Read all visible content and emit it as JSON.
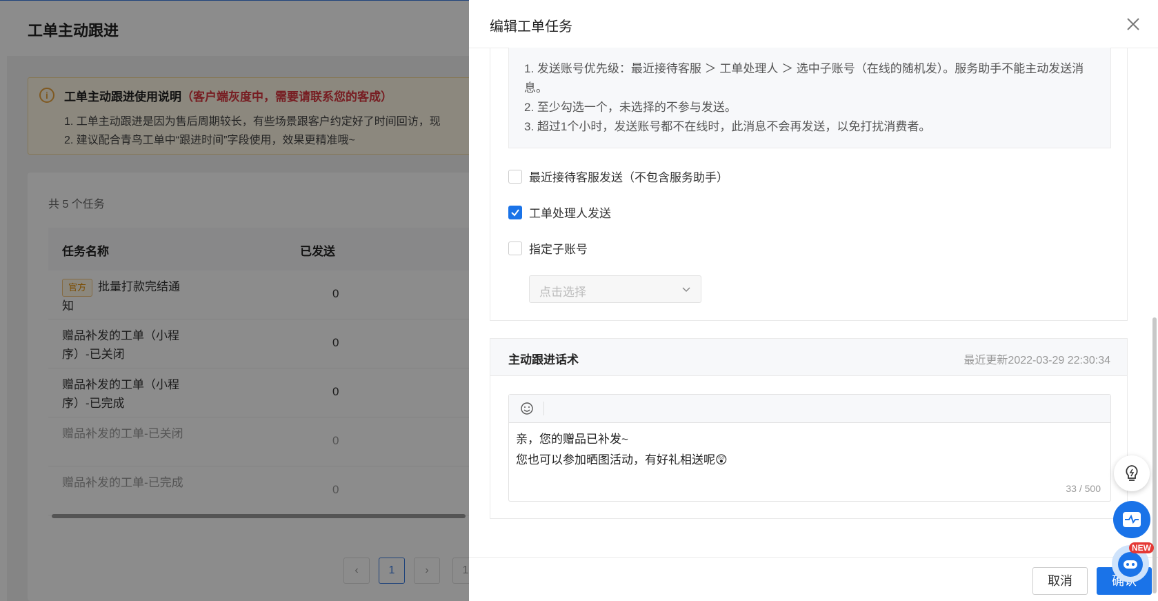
{
  "background": {
    "page_title": "工单主动跟进",
    "notice": {
      "title": "工单主动跟进使用说明",
      "title_note": "（客户端灰度中，需要请联系您的客成）",
      "line1": "1. 工单主动跟进是因为售后周期较长，有些场景跟客户约定好了时间回访，现",
      "line2": "2. 建议配合青鸟工单中“跟进时间”字段使用，效果更精准哦~"
    },
    "total": "共 5 个任务",
    "table": {
      "headers": [
        "任务名称",
        "已发送"
      ],
      "rows": [
        {
          "tag": "官方",
          "name": "批量打款完结通知",
          "sent": "0"
        },
        {
          "tag": "",
          "name": "赠品补发的工单（小程序）-已关闭",
          "sent": "0"
        },
        {
          "tag": "",
          "name": "赠品补发的工单（小程序）-已完成",
          "sent": "0"
        },
        {
          "tag": "",
          "name": "赠品补发的工单-已关闭",
          "sent": "0"
        },
        {
          "tag": "",
          "name": "赠品补发的工单-已完成",
          "sent": "0"
        }
      ]
    },
    "pager": {
      "prev": "‹",
      "current": "1",
      "next": "›",
      "goto": "1"
    }
  },
  "drawer": {
    "title": "编辑工单任务",
    "tips": [
      "1. 发送账号优先级：最近接待客服 ＞ 工单处理人 ＞ 选中子账号（在线的随机发）。服务助手不能主动发送消息。",
      "2. 至少勾选一个，未选择的不参与发送。",
      "3. 超过1个小时，发送账号都不在线时，此消息不会再发送，以免打扰消费者。"
    ],
    "options": [
      {
        "label": "最近接待客服发送（不包含服务助手）",
        "checked": false
      },
      {
        "label": "工单处理人发送",
        "checked": true
      },
      {
        "label": "指定子账号",
        "checked": false
      }
    ],
    "select_placeholder": "点击选择",
    "script_section": {
      "title": "主动跟进话术",
      "updated": "最近更新2022-03-29 22:30:34",
      "line1": "亲，您的赠品已补发~",
      "line2": "您也可以参加晒图活动，有好礼相送呢😲",
      "counter": "33 / 500"
    },
    "cancel_label": "取消",
    "ok_label": "确认"
  },
  "widgets": {
    "new_badge": "NEW"
  },
  "colors": {
    "primary": "#1a73e8",
    "warning": "#e8a33d",
    "danger": "#d9363e"
  }
}
